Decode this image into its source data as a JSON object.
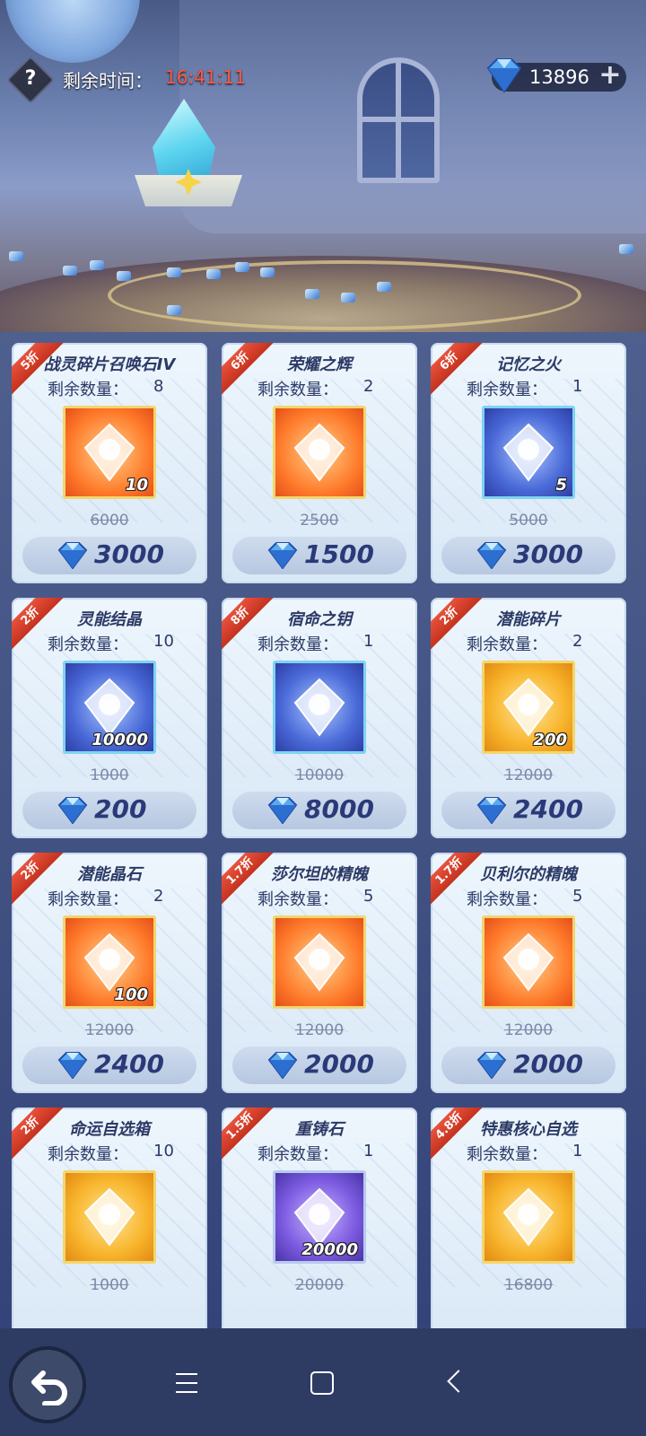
{
  "header": {
    "help_icon": "question-icon",
    "timer_label": "剩余时间：",
    "timer_value": "16:41:11",
    "currency_value": "13896",
    "currency_icon": "diamond-icon",
    "add_icon": "plus-icon"
  },
  "shop": {
    "remaining_label": "剩余数量：",
    "items": [
      {
        "discount": "5折",
        "name": "战灵碎片召唤石IV",
        "remaining": "8",
        "quantity": "10",
        "original": "6000",
        "price": "3000",
        "icon": "summon-stone-icon"
      },
      {
        "discount": "6折",
        "name": "荣耀之辉",
        "remaining": "2",
        "quantity": "",
        "original": "2500",
        "price": "1500",
        "icon": "glory-orb-icon"
      },
      {
        "discount": "6折",
        "name": "记忆之火",
        "remaining": "1",
        "quantity": "5",
        "original": "5000",
        "price": "3000",
        "icon": "flame-icon"
      },
      {
        "discount": "2折",
        "name": "灵能结晶",
        "remaining": "10",
        "quantity": "10000",
        "original": "1000",
        "price": "200",
        "icon": "psi-crystal-icon"
      },
      {
        "discount": "8折",
        "name": "宿命之钥",
        "remaining": "1",
        "quantity": "",
        "original": "10000",
        "price": "8000",
        "icon": "key-icon"
      },
      {
        "discount": "2折",
        "name": "潜能碎片",
        "remaining": "2",
        "quantity": "200",
        "original": "12000",
        "price": "2400",
        "icon": "potential-shard-icon"
      },
      {
        "discount": "2折",
        "name": "潜能晶石",
        "remaining": "2",
        "quantity": "100",
        "original": "12000",
        "price": "2400",
        "icon": "potential-stone-icon"
      },
      {
        "discount": "1.7折",
        "name": "莎尔坦的精魄",
        "remaining": "5",
        "quantity": "",
        "original": "12000",
        "price": "2000",
        "icon": "spirit-orb-icon"
      },
      {
        "discount": "1.7折",
        "name": "贝利尔的精魄",
        "remaining": "5",
        "quantity": "",
        "original": "12000",
        "price": "2000",
        "icon": "red-spirit-orb-icon"
      },
      {
        "discount": "2折",
        "name": "命运自选箱",
        "remaining": "10",
        "quantity": "",
        "original": "1000",
        "price": "",
        "icon": "chest-icon"
      },
      {
        "discount": "1.5折",
        "name": "重铸石",
        "remaining": "1",
        "quantity": "20000",
        "original": "20000",
        "price": "",
        "icon": "reforge-stone-icon"
      },
      {
        "discount": "4.8折",
        "name": "特惠核心自选",
        "remaining": "1",
        "quantity": "",
        "original": "16800",
        "price": "",
        "icon": "core-card-icon"
      }
    ]
  },
  "colors": {
    "accent": "#2a3a78",
    "discount": "#d4402a",
    "timer": "#ff5a44"
  }
}
